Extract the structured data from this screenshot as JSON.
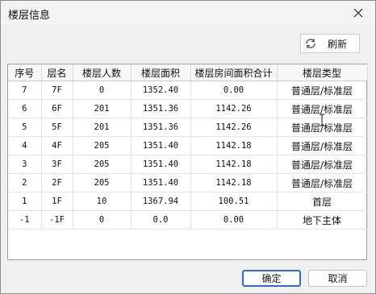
{
  "window": {
    "title": "楼层信息"
  },
  "toolbar": {
    "refresh_label": "刷新"
  },
  "table": {
    "headers": [
      "序号",
      "层名",
      "楼层人数",
      "楼层面积",
      "楼层房间面积合计",
      "楼层类型"
    ],
    "rows": [
      [
        "7",
        "7F",
        "0",
        "1352.40",
        "0.00",
        "普通层/标准层"
      ],
      [
        "6",
        "6F",
        "201",
        "1351.36",
        "1142.26",
        "普通层/标准层"
      ],
      [
        "5",
        "5F",
        "201",
        "1351.36",
        "1142.26",
        "普通层/标准层"
      ],
      [
        "4",
        "4F",
        "205",
        "1351.40",
        "1142.18",
        "普通层/标准层"
      ],
      [
        "3",
        "3F",
        "205",
        "1351.40",
        "1142.18",
        "普通层/标准层"
      ],
      [
        "2",
        "2F",
        "205",
        "1351.40",
        "1142.18",
        "普通层/标准层"
      ],
      [
        "1",
        "1F",
        "10",
        "1367.94",
        "100.51",
        "首层"
      ],
      [
        "-1",
        "-1F",
        "0",
        "0.0",
        "0.00",
        "地下主体"
      ]
    ]
  },
  "footer": {
    "ok_label": "确定",
    "cancel_label": "取消"
  },
  "icons": {
    "close": "close-icon",
    "refresh": "refresh-icon"
  }
}
